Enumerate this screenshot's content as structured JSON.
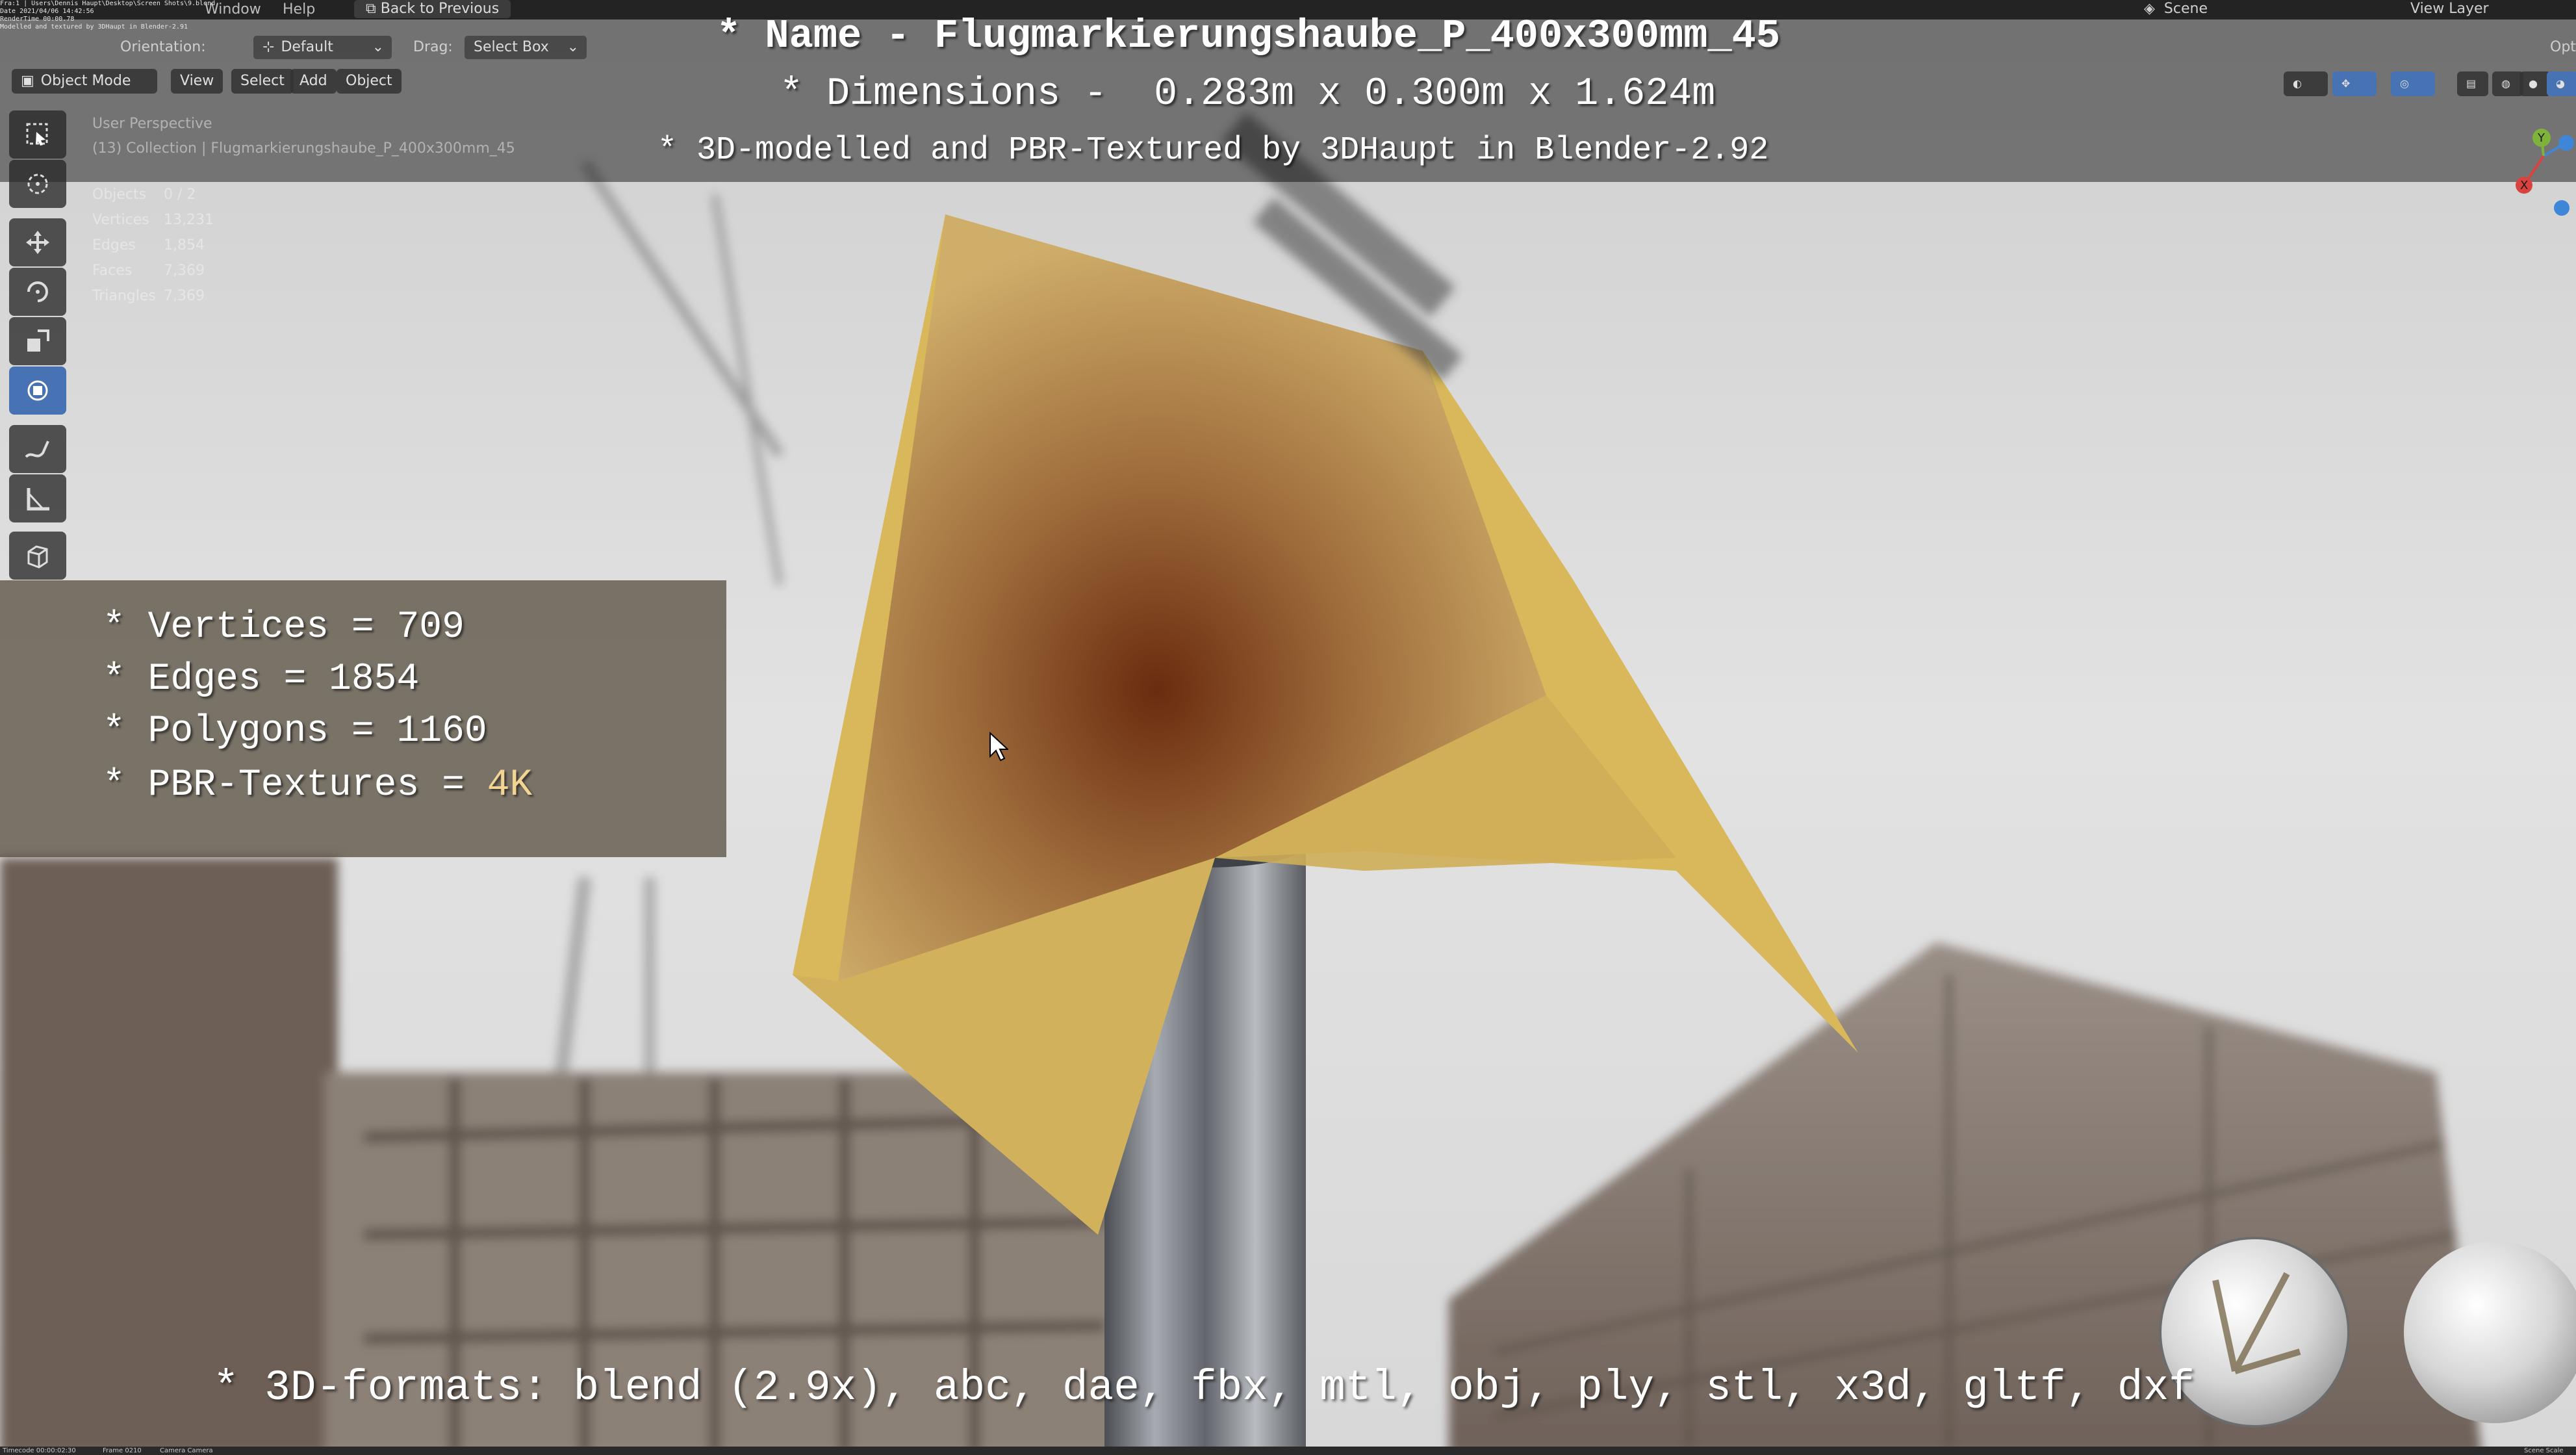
{
  "window": {
    "menus": [
      "Window",
      "Help"
    ],
    "back_button": "Back to Previous",
    "scene_label": "Scene",
    "view_layer_label": "View Layer",
    "options_label": "Opti"
  },
  "render_info": "Fra:1 | Users\\Dennis Haupt\\Desktop\\Screen Shots\\9.blend\nDate 2021/04/06 14:42:56\nRenderTime 00:00.78\nModelled and textured by 3DHaupt in Blender-2.91",
  "header": {
    "orientation_label": "Orientation:",
    "orientation_value": "Default",
    "drag_label": "Drag:",
    "drag_value": "Select Box"
  },
  "mode_row": {
    "mode": "Object Mode",
    "menus": [
      "View",
      "Select",
      "Add",
      "Object"
    ]
  },
  "viewport": {
    "perspective": "User Perspective",
    "collection": "(13) Collection | Flugmarkierungshaube_P_400x300mm_45",
    "stats": [
      {
        "k": "Objects",
        "v": "0 / 2"
      },
      {
        "k": "Vertices",
        "v": "13,231"
      },
      {
        "k": "Edges",
        "v": "1,854"
      },
      {
        "k": "Faces",
        "v": "7,369"
      },
      {
        "k": "Triangles",
        "v": "7,369"
      }
    ]
  },
  "overlay": {
    "name_line": "* Name - Flugmarkierungshaube_P_400x300mm_45",
    "dimensions_line": "* Dimensions -  0.283m x 0.300m x 1.624m",
    "credit_line": "* 3D-modelled and PBR-Textured by 3DHaupt in Blender-2.92",
    "vertices_line": "* Vertices = 709",
    "edges_line": "* Edges = 1854",
    "polygons_line": "* Polygons = 1160",
    "pbr_prefix": "* PBR-Textures = ",
    "pbr_value": "4K",
    "formats_line": "* 3D-formats: blend (2.9x), abc, dae, fbx, mtl, obj, ply, stl, x3d, gltf, dxf"
  },
  "status_bar": {
    "timecode": "Timecode 00:00:02:30",
    "frame": "Frame 0210",
    "camera": "Camera Camera",
    "scene_scale": "Scene Scale"
  },
  "colors": {
    "active_tool": "#4772b3",
    "sign_yellow": "#d8b85a",
    "pole": "#8a8f96",
    "sky": "#e3e3e3"
  },
  "icons": [
    "select-box-icon",
    "cursor-icon",
    "move-icon",
    "rotate-icon",
    "scale-icon",
    "transform-icon",
    "annotate-icon",
    "measure-icon",
    "add-cube-icon"
  ]
}
